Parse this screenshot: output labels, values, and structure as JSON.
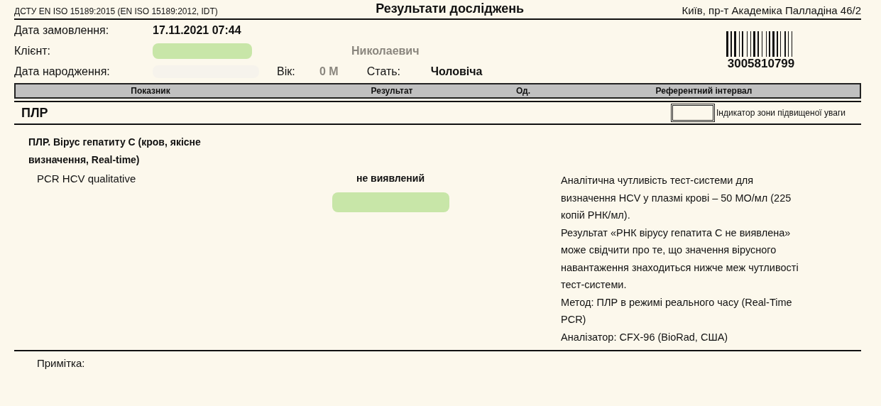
{
  "header": {
    "standard": "ДСТУ EN ISO 15189:2015 (EN ISO 15189:2012, IDT)",
    "title": "Результати досліджень",
    "address": "Київ, пр-т Академіка Палладіна 46/2"
  },
  "patient": {
    "order_date_label": "Дата замовлення:",
    "order_date": "17.11.2021  07:44",
    "client_label": "Клієнт:",
    "client_name": "Николаевич",
    "birth_label": "Дата народження:",
    "age_label": "Вік:",
    "age": "0 М",
    "sex_label": "Стать:",
    "sex": "Чоловіча"
  },
  "barcode": {
    "number": "3005810799"
  },
  "table": {
    "columns": [
      "Показник",
      "Результат",
      "Од.",
      "Референтний інтервал"
    ],
    "section": "ПЛР",
    "legend": "Індикатор зони підвищеної уваги",
    "group": "ПЛР. Вірус гепатиту С (кров, якісне визначення, Real-time)",
    "rows": [
      {
        "name": "PCR HCV qualitative",
        "result": "не виявлений",
        "reference": [
          "Аналітична чутливість тест-системи для визначення HCV у плазмі крові – 50 МО/мл (225 копій РНК/мл).",
          "Результат «РНК вірусу гепатита С не виявлена» може свідчити про те, що значення вірусного навантаження знаходиться нижче меж чутливості тест-системи.",
          "Метод: ПЛР в режимі реального часу (Real-Time PCR)",
          "Аналізатор: CFX-96 (BioRad, США)"
        ]
      }
    ]
  },
  "note_label": "Примітка:"
}
